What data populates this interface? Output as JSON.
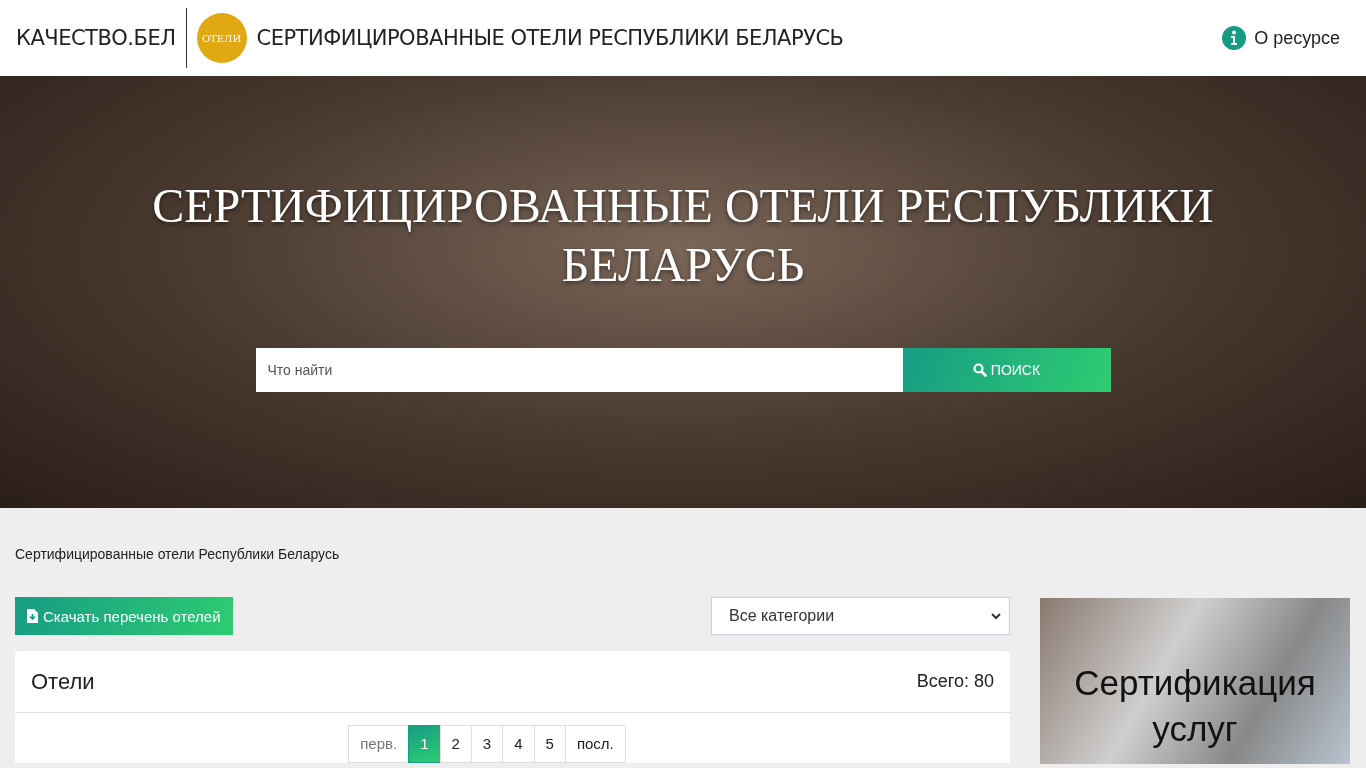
{
  "header": {
    "brand": "КАЧЕСТВО.БЕЛ",
    "logo_text": "ОТЕЛИ",
    "title": "СЕРТИФИЦИРОВАННЫЕ ОТЕЛИ РЕСПУБЛИКИ БЕЛАРУСЬ",
    "about_link": "О ресурсе"
  },
  "hero": {
    "title": "СЕРТИФИЦИРОВАННЫЕ ОТЕЛИ РЕСПУБЛИКИ БЕЛАРУСЬ",
    "search": {
      "placeholder": "Что найти"
    },
    "search_button": "ПОИСК"
  },
  "breadcrumb": "Сертифицированные отели Республики Беларусь",
  "download_button": "Скачать перечень отелей",
  "category_select": {
    "value": "Все категории"
  },
  "hotels_panel": {
    "title": "Отели",
    "total": "Всего: 80",
    "pagination": [
      {
        "label": "перв.",
        "selected": false
      },
      {
        "label": "1",
        "selected": true
      },
      {
        "label": "2",
        "selected": false
      },
      {
        "label": "3",
        "selected": false
      },
      {
        "label": "4",
        "selected": false
      },
      {
        "label": "5",
        "selected": false
      },
      {
        "label": "посл.",
        "selected": false
      }
    ]
  },
  "side_banner": {
    "caption": "Сертификация услуг"
  }
}
